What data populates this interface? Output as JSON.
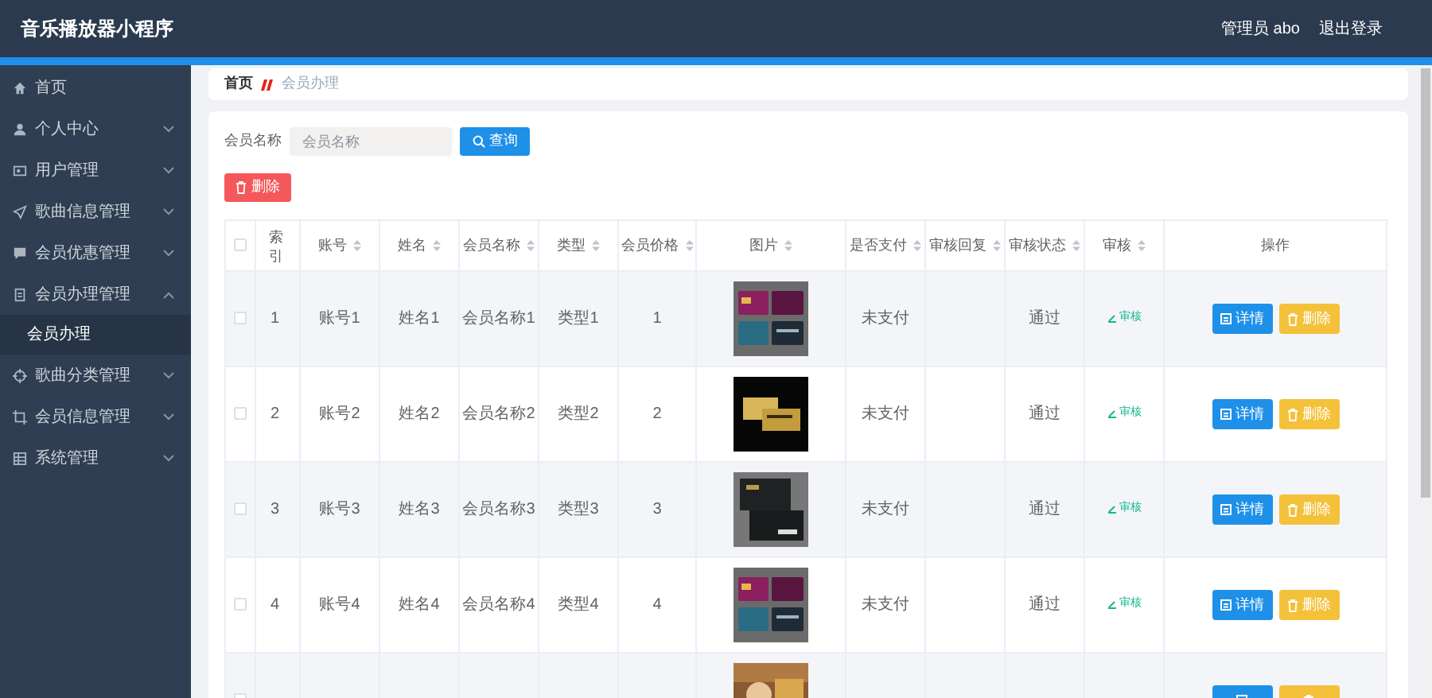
{
  "header": {
    "title": "音乐播放器小程序",
    "user": "管理员 abo",
    "logout": "退出登录"
  },
  "sidebar": {
    "items": [
      {
        "label": "首页",
        "kind": "link"
      },
      {
        "label": "个人中心",
        "kind": "menu",
        "expanded": false
      },
      {
        "label": "用户管理",
        "kind": "menu",
        "expanded": false
      },
      {
        "label": "歌曲信息管理",
        "kind": "menu",
        "expanded": false
      },
      {
        "label": "会员优惠管理",
        "kind": "menu",
        "expanded": false
      },
      {
        "label": "会员办理管理",
        "kind": "menu",
        "expanded": true,
        "children": [
          {
            "label": "会员办理",
            "selected": true
          }
        ]
      },
      {
        "label": "歌曲分类管理",
        "kind": "menu",
        "expanded": false
      },
      {
        "label": "会员信息管理",
        "kind": "menu",
        "expanded": false
      },
      {
        "label": "系统管理",
        "kind": "menu",
        "expanded": false
      }
    ]
  },
  "breadcrumb": {
    "home": "首页",
    "current": "会员办理"
  },
  "search": {
    "label": "会员名称",
    "placeholder": "会员名称",
    "button": "查询"
  },
  "delete_button": "删除",
  "table": {
    "select_all_checked": false,
    "columns": [
      {
        "label": "索引",
        "sortable": false
      },
      {
        "label": "账号",
        "sortable": true
      },
      {
        "label": "姓名",
        "sortable": true
      },
      {
        "label": "会员名称",
        "sortable": true
      },
      {
        "label": "类型",
        "sortable": true
      },
      {
        "label": "会员价格",
        "sortable": true
      },
      {
        "label": "图片",
        "sortable": true
      },
      {
        "label": "是否支付",
        "sortable": true
      },
      {
        "label": "审核回复",
        "sortable": true
      },
      {
        "label": "审核状态",
        "sortable": true
      },
      {
        "label": "审核",
        "sortable": true
      },
      {
        "label": "操作",
        "sortable": false
      }
    ],
    "rows": [
      {
        "checked": false,
        "index": "1",
        "account": "账号1",
        "name": "姓名1",
        "member_name": "会员名称1",
        "type": "类型1",
        "price": "1",
        "paid": "未支付",
        "status": "通过",
        "review": "审核",
        "detail": "详情",
        "delete": "删除"
      },
      {
        "checked": false,
        "index": "2",
        "account": "账号2",
        "name": "姓名2",
        "member_name": "会员名称2",
        "type": "类型2",
        "price": "2",
        "paid": "未支付",
        "status": "通过",
        "review": "审核",
        "detail": "详情",
        "delete": "删除"
      },
      {
        "checked": false,
        "index": "3",
        "account": "账号3",
        "name": "姓名3",
        "member_name": "会员名称3",
        "type": "类型3",
        "price": "3",
        "paid": "未支付",
        "status": "通过",
        "review": "审核",
        "detail": "详情",
        "delete": "删除"
      },
      {
        "checked": false,
        "index": "4",
        "account": "账号4",
        "name": "姓名4",
        "member_name": "会员名称4",
        "type": "类型4",
        "price": "4",
        "paid": "未支付",
        "status": "通过",
        "review": "审核",
        "detail": "详情",
        "delete": "删除"
      },
      {
        "checked": false
      }
    ]
  }
}
